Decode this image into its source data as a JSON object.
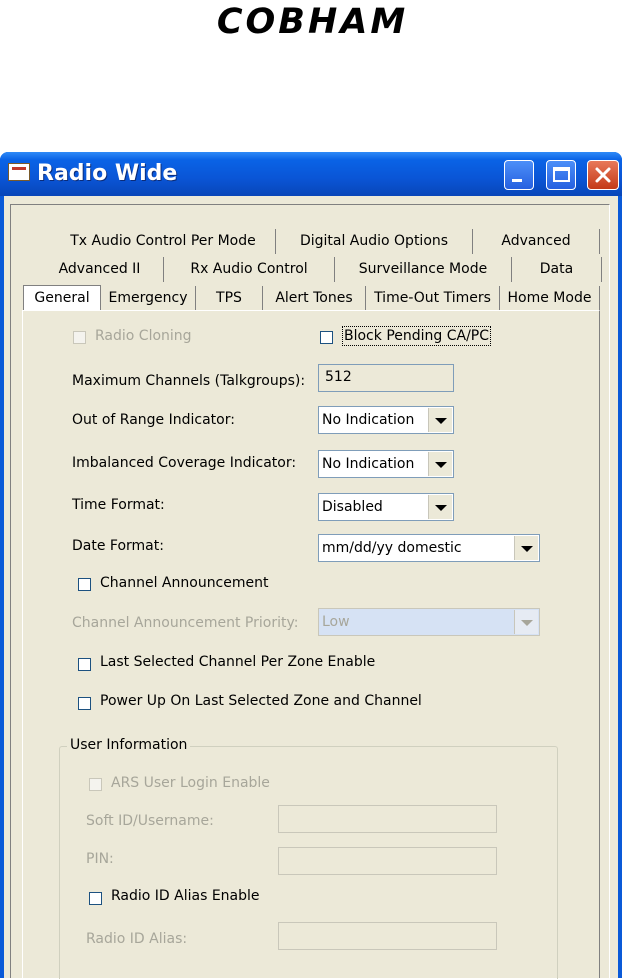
{
  "logo": "COBHAM",
  "window": {
    "title": "Radio Wide",
    "minimize": "",
    "maximize": "",
    "close": ""
  },
  "tabs": {
    "row1": [
      "Tx Audio Control Per Mode",
      "Digital Audio Options",
      "Advanced"
    ],
    "row2": [
      "Advanced II",
      "Rx Audio Control",
      "Surveillance Mode",
      "Data"
    ],
    "row3": [
      "General",
      "Emergency",
      "TPS",
      "Alert Tones",
      "Time-Out Timers",
      "Home Mode"
    ],
    "selected": "General"
  },
  "general": {
    "radio_cloning": "Radio Cloning",
    "block_pending": "Block Pending CA/PC",
    "max_channels_label": "Maximum Channels (Talkgroups):",
    "max_channels_value": "512",
    "out_of_range_label": "Out of Range Indicator:",
    "out_of_range_value": "No Indication",
    "imbalanced_label": "Imbalanced Coverage Indicator:",
    "imbalanced_value": "No Indication",
    "time_format_label": "Time Format:",
    "time_format_value": "Disabled",
    "date_format_label": "Date Format:",
    "date_format_value": "mm/dd/yy domestic",
    "channel_announcement": "Channel Announcement",
    "channel_announcement_priority_label": "Channel Announcement Priority:",
    "channel_announcement_priority_value": "Low",
    "last_selected_channel": "Last Selected Channel Per Zone Enable",
    "power_up_last": "Power Up On Last Selected Zone and Channel"
  },
  "user_info": {
    "title": "User Information",
    "ars_login": "ARS User Login Enable",
    "soft_id_label": "Soft ID/Username:",
    "soft_id_value": "",
    "pin_label": "PIN:",
    "pin_value": "",
    "radio_id_alias_enable": "Radio ID Alias Enable",
    "radio_id_alias_label": "Radio ID Alias:",
    "radio_id_alias_value": ""
  }
}
